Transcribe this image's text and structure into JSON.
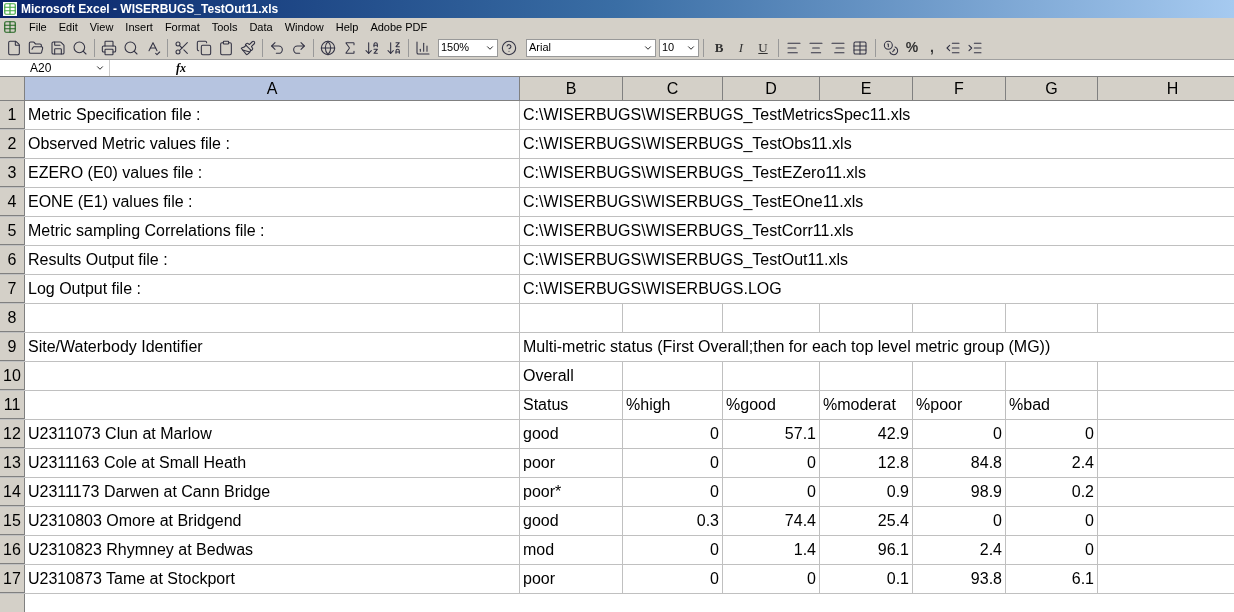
{
  "window": {
    "title": "Microsoft Excel - WISERBUGS_TestOut11.xls"
  },
  "menu": [
    "File",
    "Edit",
    "View",
    "Insert",
    "Format",
    "Tools",
    "Data",
    "Window",
    "Help",
    "Adobe PDF"
  ],
  "toolbar": {
    "zoom": "150%",
    "font": "Arial",
    "font_size": "10",
    "style_buttons": [
      "B",
      "I",
      "U"
    ],
    "number_buttons": [
      "%",
      ","
    ]
  },
  "formula_bar": {
    "name_box": "A20",
    "fx": "fx"
  },
  "columns": [
    "A",
    "B",
    "C",
    "D",
    "E",
    "F",
    "G",
    "H"
  ],
  "rows": [
    {
      "number": "1",
      "kind": "wide",
      "label": "Metric Specification file :",
      "value": "C:\\WISERBUGS\\WISERBUGS_TestMetricsSpec11.xls"
    },
    {
      "number": "2",
      "kind": "wide",
      "label": "Observed Metric values file :",
      "value": "C:\\WISERBUGS\\WISERBUGS_TestObs11.xls"
    },
    {
      "number": "3",
      "kind": "wide",
      "label": "EZERO (E0) values file :",
      "value": "C:\\WISERBUGS\\WISERBUGS_TestEZero11.xls"
    },
    {
      "number": "4",
      "kind": "wide",
      "label": "EONE (E1) values file :",
      "value": "C:\\WISERBUGS\\WISERBUGS_TestEOne11.xls"
    },
    {
      "number": "5",
      "kind": "wide",
      "label": "Metric sampling Correlations file :",
      "value": "C:\\WISERBUGS\\WISERBUGS_TestCorr11.xls"
    },
    {
      "number": "6",
      "kind": "wide",
      "label": "Results Output file :",
      "value": "C:\\WISERBUGS\\WISERBUGS_TestOut11.xls"
    },
    {
      "number": "7",
      "kind": "wide",
      "label": "Log Output file :",
      "value": "C:\\WISERBUGS\\WISERBUGS.LOG"
    },
    {
      "number": "8",
      "kind": "text",
      "cells": []
    },
    {
      "number": "9",
      "kind": "wide",
      "label": "Site/Waterbody Identifier",
      "value": "Multi-metric status (First Overall;then for each top level metric group (MG))"
    },
    {
      "number": "10",
      "kind": "text",
      "cells": [
        "Overall"
      ]
    },
    {
      "number": "11",
      "kind": "text",
      "cells": [
        "Status",
        "%high",
        "%good",
        "%moderat",
        "%poor",
        "%bad"
      ]
    },
    {
      "number": "12",
      "kind": "data",
      "label": "U2311073 Clun at Marlow",
      "cells": [
        "good",
        "0",
        "57.1",
        "42.9",
        "0",
        "0"
      ]
    },
    {
      "number": "13",
      "kind": "data",
      "label": "U2311163 Cole at Small Heath",
      "cells": [
        "poor",
        "0",
        "0",
        "12.8",
        "84.8",
        "2.4"
      ]
    },
    {
      "number": "14",
      "kind": "data",
      "label": "U2311173 Darwen at Cann Bridge",
      "cells": [
        "poor*",
        "0",
        "0",
        "0.9",
        "98.9",
        "0.2"
      ]
    },
    {
      "number": "15",
      "kind": "data",
      "label": "U2310803 Omore at Bridgend",
      "cells": [
        "good",
        "0.3",
        "74.4",
        "25.4",
        "0",
        "0"
      ]
    },
    {
      "number": "16",
      "kind": "data",
      "label": "U2310823 Rhymney at Bedwas",
      "cells": [
        "mod",
        "0",
        "1.4",
        "96.1",
        "2.4",
        "0"
      ]
    },
    {
      "number": "17",
      "kind": "data",
      "label": "U2310873 Tame at Stockport",
      "cells": [
        "poor",
        "0",
        "0",
        "0.1",
        "93.8",
        "6.1"
      ]
    }
  ]
}
